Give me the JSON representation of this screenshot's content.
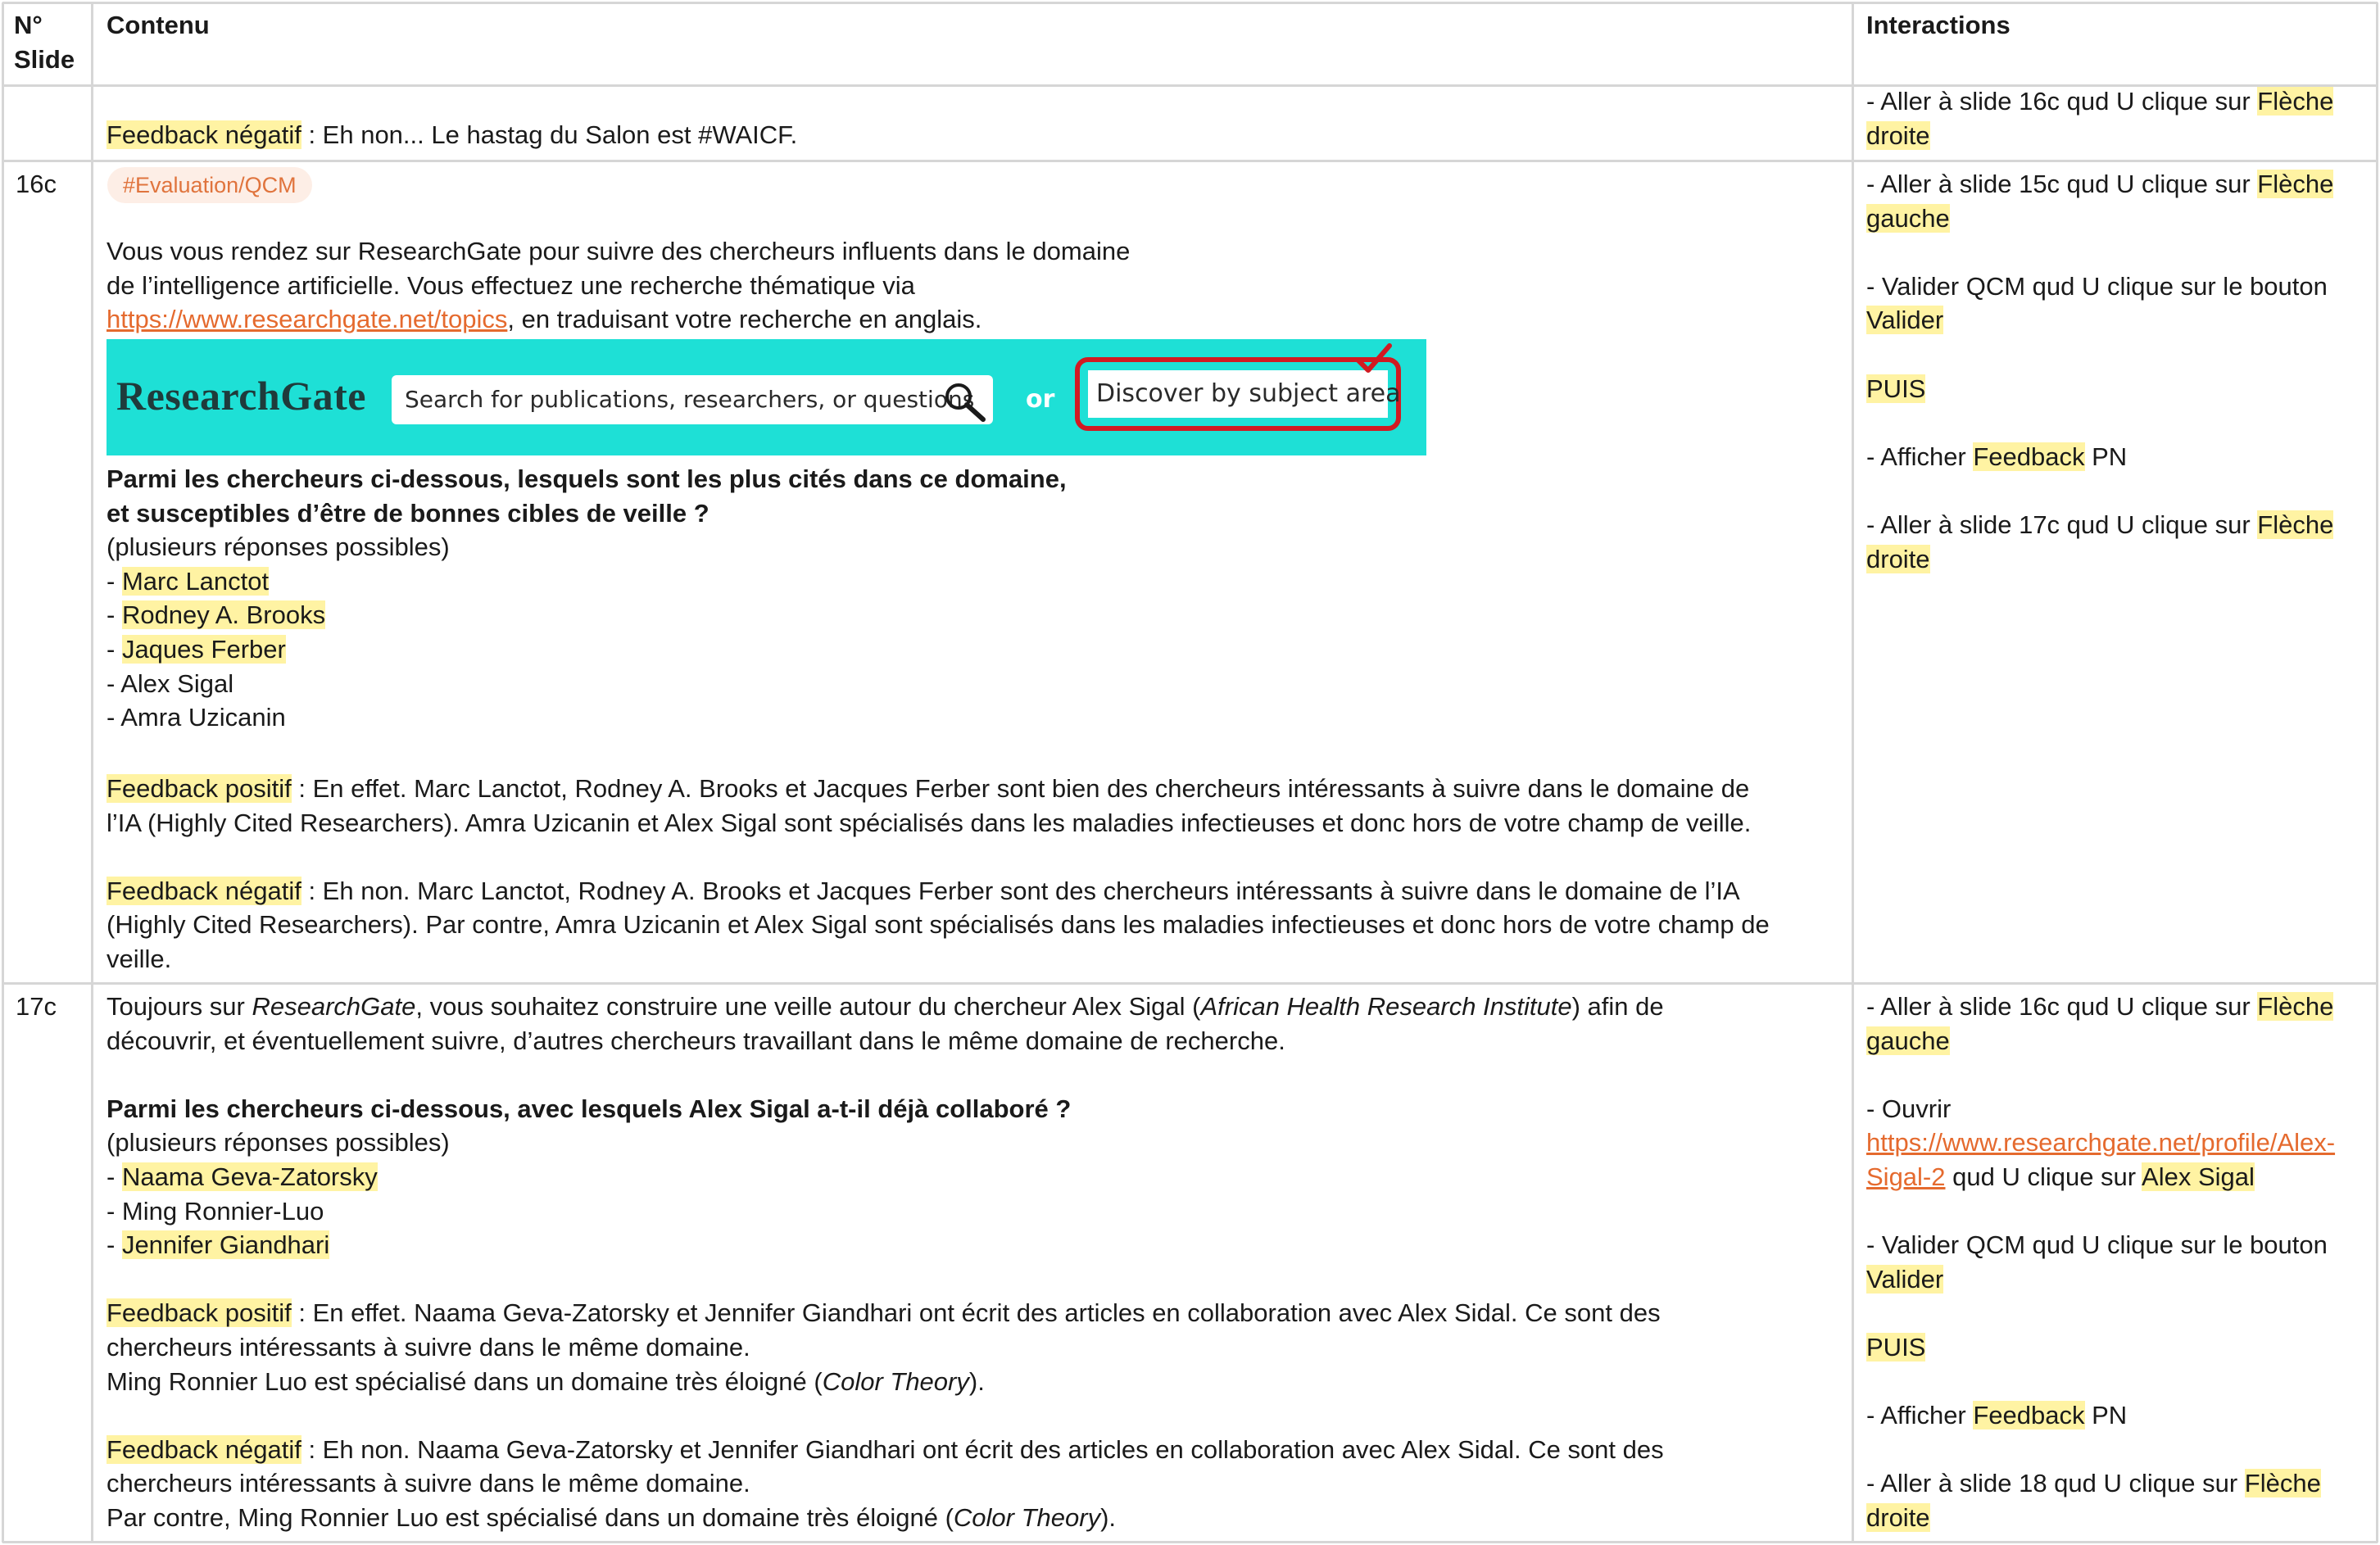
{
  "headers": {
    "slide": [
      "N°",
      "Slide"
    ],
    "content": "Contenu",
    "interactions": "Interactions"
  },
  "colors": {
    "highlight": "#fff3a3",
    "link": "#e56a2e",
    "tag_bg": "#fdeee6",
    "banner": "#1ee0d6",
    "red": "#d11a22"
  },
  "row_prev": {
    "content_lines": [
      [
        {
          "t": "Feedback négatif",
          "s": "hl"
        },
        {
          "t": " : Eh non... Le hastag du Salon est #WAICF."
        }
      ]
    ],
    "interaction_lines": [
      [
        {
          "t": "- Aller à slide 16c qud U clique sur "
        },
        {
          "t": "Flèche",
          "s": "hl"
        }
      ],
      [
        {
          "t": "droite",
          "s": "hl"
        }
      ]
    ]
  },
  "row_16c": {
    "slide": "16c",
    "tag": "#Evaluation/QCM",
    "intro_lines": [
      [
        {
          "t": "Vous vous rendez sur ResearchGate pour suivre des chercheurs influents dans le domaine"
        }
      ],
      [
        {
          "t": "de l’intelligence artificielle. Vous effectuez une recherche thématique via"
        }
      ],
      [
        {
          "t": "https://www.researchgate.net/topics",
          "s": "lnk",
          "n": "topics-link",
          "i": true
        },
        {
          "t": ", en traduisant votre recherche en anglais."
        }
      ]
    ],
    "banner": {
      "logo": "ResearchGate",
      "search_placeholder": "Search for publications, researchers, or questions",
      "search_icon": "magnifier-icon",
      "or": "or",
      "discover": "Discover by subject area",
      "check_icon": "checkmark-icon"
    },
    "question_lines": [
      [
        {
          "t": "Parmi les chercheurs ci-dessous, lesquels sont les plus cités dans ce domaine,",
          "s": "bld"
        }
      ],
      [
        {
          "t": "et susceptibles d’être de bonnes cibles de veille ?",
          "s": "bld"
        }
      ],
      [
        {
          "t": "(plusieurs réponses possibles)"
        }
      ],
      [
        {
          "t": "- "
        },
        {
          "t": "Marc Lanctot",
          "s": "hl"
        }
      ],
      [
        {
          "t": "- "
        },
        {
          "t": "Rodney A. Brooks",
          "s": "hl"
        }
      ],
      [
        {
          "t": "- "
        },
        {
          "t": "Jaques Ferber",
          "s": "hl"
        }
      ],
      [
        {
          "t": "- Alex Sigal"
        }
      ],
      [
        {
          "t": "- Amra Uzicanin"
        }
      ]
    ],
    "feedback_lines": [
      [
        {
          "t": "Feedback positif",
          "s": "hl"
        },
        {
          "t": " : En effet. Marc Lanctot, Rodney A. Brooks et Jacques Ferber sont bien des chercheurs intéressants à suivre dans le domaine de"
        }
      ],
      [
        {
          "t": "l’IA (Highly Cited Researchers). Amra Uzicanin et Alex Sigal sont spécialisés dans les maladies infectieuses et donc hors de votre champ de veille."
        }
      ],
      [],
      [
        {
          "t": "Feedback négatif",
          "s": "hl"
        },
        {
          "t": " : Eh non. Marc Lanctot, Rodney A. Brooks et Jacques Ferber sont des chercheurs intéressants à suivre dans le domaine de l’IA"
        }
      ],
      [
        {
          "t": "(Highly Cited Researchers). Par contre, Amra Uzicanin et Alex Sigal sont spécialisés dans les maladies infectieuses et donc hors de votre champ de"
        }
      ],
      [
        {
          "t": "veille."
        }
      ]
    ],
    "interaction_lines": [
      [
        {
          "t": "- Aller à slide 15c qud U clique sur "
        },
        {
          "t": "Flèche",
          "s": "hl"
        }
      ],
      [
        {
          "t": "gauche",
          "s": "hl"
        }
      ],
      [],
      [
        {
          "t": "- Valider QCM qud U clique sur le bouton"
        }
      ],
      [
        {
          "t": "Valider",
          "s": "hl"
        }
      ],
      [],
      [
        {
          "t": "PUIS",
          "s": "hl"
        }
      ],
      [],
      [
        {
          "t": "- Afficher "
        },
        {
          "t": "Feedback",
          "s": "hl"
        },
        {
          "t": " PN"
        }
      ],
      [],
      [
        {
          "t": "- Aller à slide 17c qud U clique sur "
        },
        {
          "t": "Flèche",
          "s": "hl"
        }
      ],
      [
        {
          "t": "droite",
          "s": "hl"
        }
      ]
    ]
  },
  "row_17c": {
    "slide": "17c",
    "content_lines": [
      [
        {
          "t": "Toujours sur "
        },
        {
          "t": "ResearchGate",
          "s": "ital"
        },
        {
          "t": ", vous souhaitez construire une veille autour du chercheur Alex Sigal ("
        },
        {
          "t": "African Health Research Institute",
          "s": "ital"
        },
        {
          "t": ") afin de"
        }
      ],
      [
        {
          "t": "découvrir, et éventuellement suivre, d’autres chercheurs travaillant dans le même domaine de recherche."
        }
      ],
      [],
      [
        {
          "t": "Parmi les chercheurs ci-dessous, avec lesquels Alex Sigal a-t-il déjà collaboré ?",
          "s": "bld"
        }
      ],
      [
        {
          "t": "(plusieurs réponses possibles)"
        }
      ],
      [
        {
          "t": "- "
        },
        {
          "t": "Naama Geva-Zatorsky",
          "s": "hl"
        }
      ],
      [
        {
          "t": "- Ming Ronnier-Luo"
        }
      ],
      [
        {
          "t": "- "
        },
        {
          "t": "Jennifer Giandhari",
          "s": "hl"
        }
      ],
      [],
      [
        {
          "t": "Feedback positif",
          "s": "hl"
        },
        {
          "t": " : En effet. Naama Geva-Zatorsky et Jennifer Giandhari ont écrit des articles en collaboration avec Alex Sidal. Ce sont des"
        }
      ],
      [
        {
          "t": "chercheurs intéressants à suivre dans le même domaine."
        }
      ],
      [
        {
          "t": "Ming Ronnier Luo est spécialisé dans un domaine très éloigné ("
        },
        {
          "t": "Color Theory",
          "s": "ital"
        },
        {
          "t": ")."
        }
      ],
      [],
      [
        {
          "t": "Feedback négatif",
          "s": "hl"
        },
        {
          "t": " : Eh non. Naama Geva-Zatorsky et Jennifer Giandhari ont écrit des articles en collaboration avec Alex Sidal. Ce sont des"
        }
      ],
      [
        {
          "t": "chercheurs intéressants à suivre dans le même domaine."
        }
      ],
      [
        {
          "t": "Par contre, Ming Ronnier Luo est spécialisé dans un domaine très éloigné ("
        },
        {
          "t": "Color Theory",
          "s": "ital"
        },
        {
          "t": ")."
        }
      ]
    ],
    "interaction_lines": [
      [
        {
          "t": "- Aller à slide 16c qud U clique sur "
        },
        {
          "t": "Flèche",
          "s": "hl"
        }
      ],
      [
        {
          "t": "gauche",
          "s": "hl"
        }
      ],
      [],
      [
        {
          "t": "- Ouvrir"
        }
      ],
      [
        {
          "t": "https://www.researchgate.net/profile/Alex-",
          "s": "lnk",
          "n": "profile-link",
          "i": true
        }
      ],
      [
        {
          "t": "Sigal-2",
          "s": "lnk",
          "n": "profile-link",
          "i": true
        },
        {
          "t": " qud U clique sur "
        },
        {
          "t": "Alex Sigal",
          "s": "hl"
        }
      ],
      [],
      [
        {
          "t": "- Valider QCM qud U clique sur le bouton"
        }
      ],
      [
        {
          "t": "Valider",
          "s": "hl"
        }
      ],
      [],
      [
        {
          "t": "PUIS",
          "s": "hl"
        }
      ],
      [],
      [
        {
          "t": "- Afficher "
        },
        {
          "t": "Feedback",
          "s": "hl"
        },
        {
          "t": " PN"
        }
      ],
      [],
      [
        {
          "t": "- Aller à slide 18 qud U clique sur "
        },
        {
          "t": "Flèche",
          "s": "hl"
        }
      ],
      [
        {
          "t": "droite",
          "s": "hl"
        }
      ]
    ]
  }
}
